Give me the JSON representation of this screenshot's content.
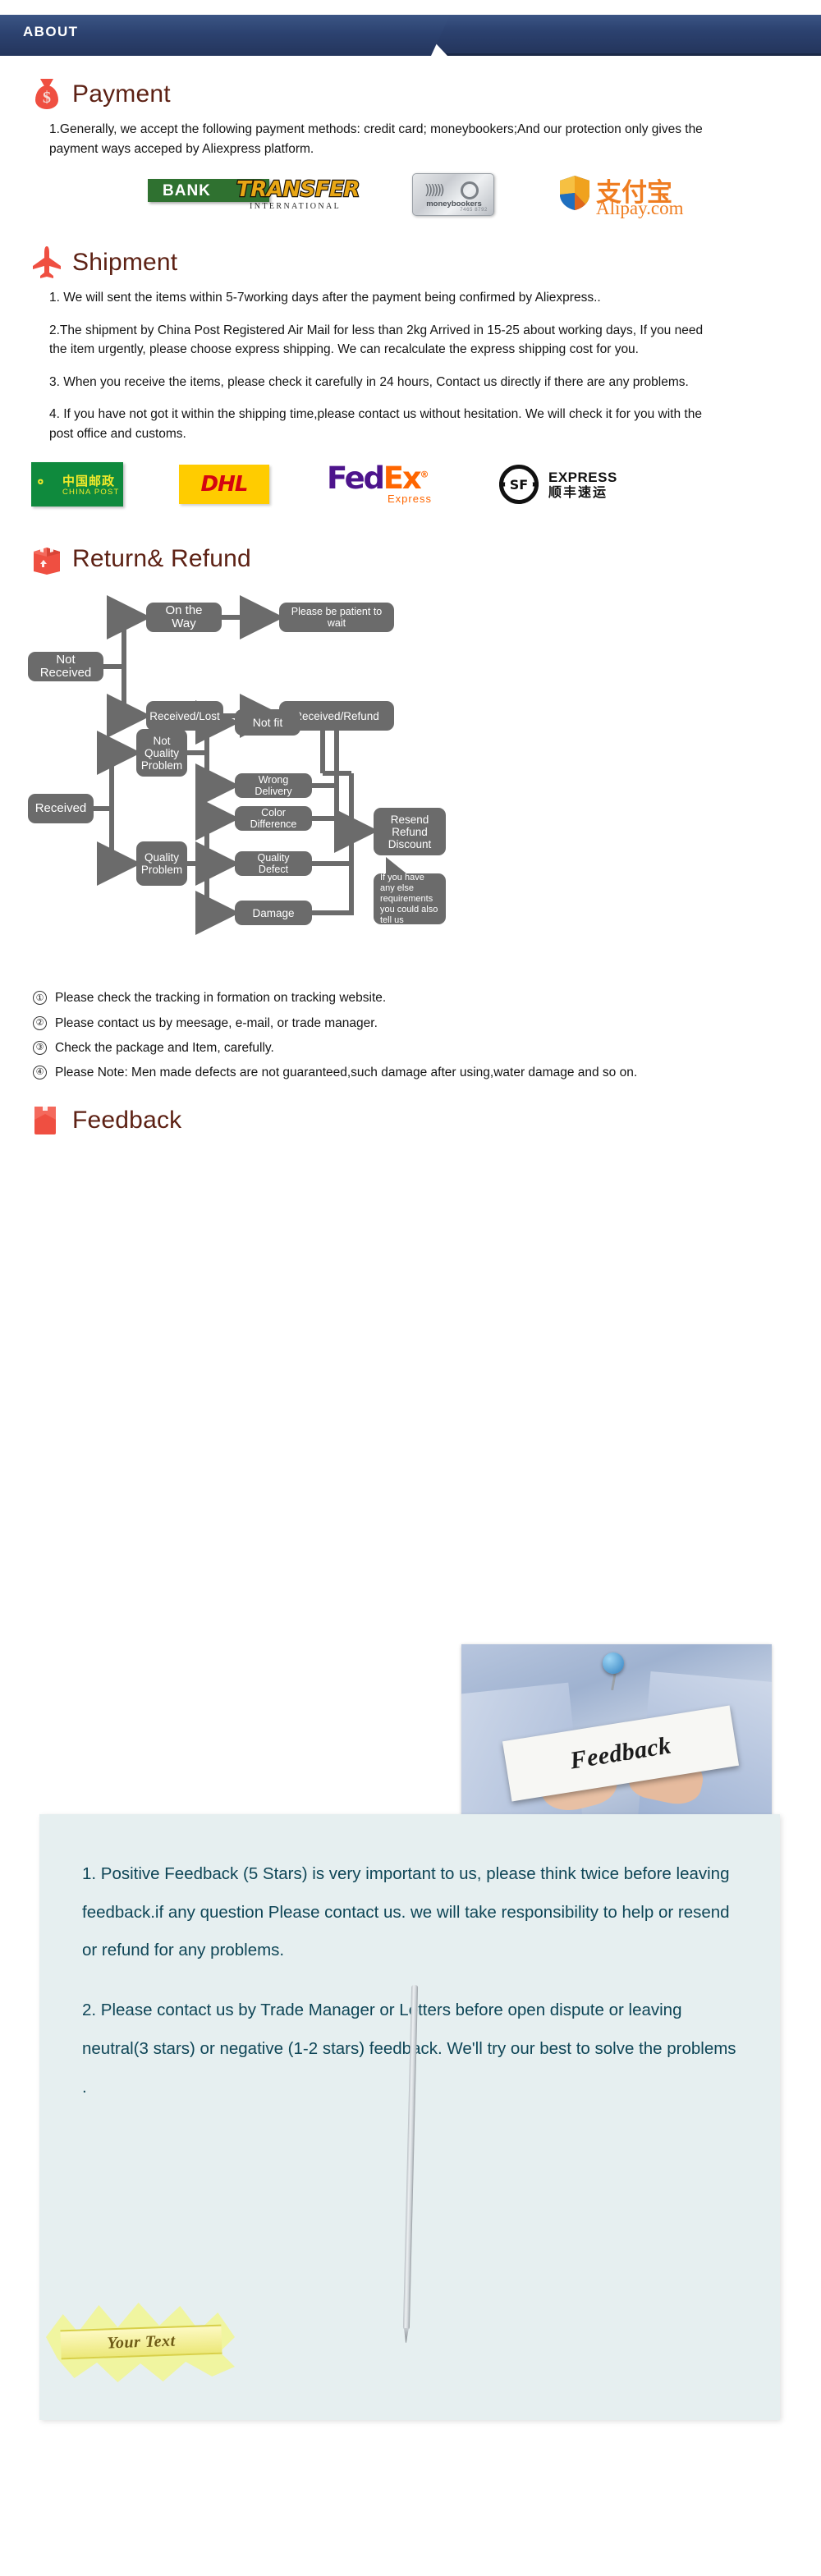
{
  "header": {
    "tab_label": "ABOUT"
  },
  "payment": {
    "icon": "money-bag-icon",
    "title": "Payment",
    "paragraphs": [
      "1.Generally, we accept the following payment methods: credit card; moneybookers;And our protection only gives the payment ways acceped by Aliexpress platform."
    ],
    "logos": [
      {
        "name": "bank-transfer-logo",
        "bank": "BANK",
        "transfer": "TRANSFER",
        "international": "INTERNATIONAL"
      },
      {
        "name": "moneybookers-logo",
        "label": "moneybookers",
        "card_number": "7465 8792"
      },
      {
        "name": "alipay-logo",
        "chinese": "支付宝",
        "domain": "Alipay.com"
      }
    ]
  },
  "shipment": {
    "icon": "airplane-icon",
    "title": "Shipment",
    "paragraphs": [
      "1. We will sent the items within 5-7working days after the payment being confirmed by Aliexpress..",
      "2.The shipment by China Post Registered Air Mail for less than  2kg Arrived in 15-25 about working days, If  you need the item urgently, please choose express shipping. We can recalculate the express shipping cost for you.",
      "3. When you receive the items, please check it carefully in 24 hours, Contact us directly if there are any problems.",
      "4. If you have not got it within the shipping time,please contact us without hesitation. We will check it for you with the post office and customs."
    ],
    "carriers": [
      {
        "name": "china-post-logo",
        "chinese": "中国邮政",
        "english": "CHINA POST"
      },
      {
        "name": "dhl-logo",
        "text": "DHL"
      },
      {
        "name": "fedex-logo",
        "fed": "Fed",
        "ex": "Ex",
        "express": "Express"
      },
      {
        "name": "sf-express-logo",
        "mark": "SF",
        "english": "EXPRESS",
        "chinese": "顺丰速运"
      }
    ]
  },
  "return_refund": {
    "icon": "package-box-icon",
    "title": "Return& Refund",
    "flowchart": {
      "type": "flowchart",
      "nodes": [
        {
          "id": "not-received",
          "label": "Not Received"
        },
        {
          "id": "on-the-way",
          "label": "On the Way"
        },
        {
          "id": "please-wait",
          "label": "Please be patient to wait"
        },
        {
          "id": "received-lost",
          "label": "Received/Lost"
        },
        {
          "id": "received-refund",
          "label": "Received/Refund"
        },
        {
          "id": "received",
          "label": "Received"
        },
        {
          "id": "not-quality-problem",
          "label": "Not Quality Problem"
        },
        {
          "id": "quality-problem",
          "label": "Quality Problem"
        },
        {
          "id": "not-fit",
          "label": "Not fit"
        },
        {
          "id": "wrong-delivery",
          "label": "Wrong Delivery"
        },
        {
          "id": "color-difference",
          "label": "Color Difference"
        },
        {
          "id": "quality-defect",
          "label": "Quality Defect"
        },
        {
          "id": "damage",
          "label": "Damage"
        },
        {
          "id": "resend-refund-discount",
          "label": "Resend Refund Discount"
        },
        {
          "id": "callout",
          "label": "If you have any else requirements you could also tell us"
        }
      ],
      "edges": [
        [
          "not-received",
          "on-the-way"
        ],
        [
          "on-the-way",
          "please-wait"
        ],
        [
          "not-received",
          "received-lost"
        ],
        [
          "received-lost",
          "received-refund"
        ],
        [
          "received",
          "not-quality-problem"
        ],
        [
          "received",
          "quality-problem"
        ],
        [
          "not-quality-problem",
          "not-fit"
        ],
        [
          "not-quality-problem",
          "wrong-delivery"
        ],
        [
          "quality-problem",
          "color-difference"
        ],
        [
          "quality-problem",
          "quality-defect"
        ],
        [
          "quality-problem",
          "damage"
        ],
        [
          "not-fit",
          "resend-refund-discount"
        ],
        [
          "wrong-delivery",
          "resend-refund-discount"
        ],
        [
          "color-difference",
          "resend-refund-discount"
        ],
        [
          "quality-defect",
          "resend-refund-discount"
        ],
        [
          "damage",
          "resend-refund-discount"
        ]
      ]
    },
    "numbered_items": [
      {
        "marker": "①",
        "text": "Please check the tracking in formation on tracking website."
      },
      {
        "marker": "②",
        "text": "Please contact us by meesage, e-mail, or trade manager."
      },
      {
        "marker": "③",
        "text": "Check the package and Item, carefully."
      },
      {
        "marker": "④",
        "text": "Please Note: Men made defects  are not guaranteed,such damage after using,water damage and so on."
      }
    ]
  },
  "feedback": {
    "icon": "feedback-tag-icon",
    "title": "Feedback",
    "photo_card_text": "Feedback",
    "paragraphs": [
      "1. Positive Feedback (5 Stars) is very important to us, please think twice before leaving feedback.if any question Please contact  us. we will take responsibility to help or resend or refund for any problems.",
      "2. Please contact us by Trade Manager or Letters before open dispute or leaving neutral(3 stars) or negative (1-2 stars) feedback. We'll try our best to solve the problems ."
    ],
    "banner_text": "Your Text"
  },
  "colors": {
    "header_blue": "#2c4270",
    "heading_brown": "#5d2114",
    "icon_red": "#ef4f41",
    "flow_gray": "#6b6b6b",
    "feedback_bg": "#e6eff0",
    "feedback_text": "#0f4657"
  }
}
